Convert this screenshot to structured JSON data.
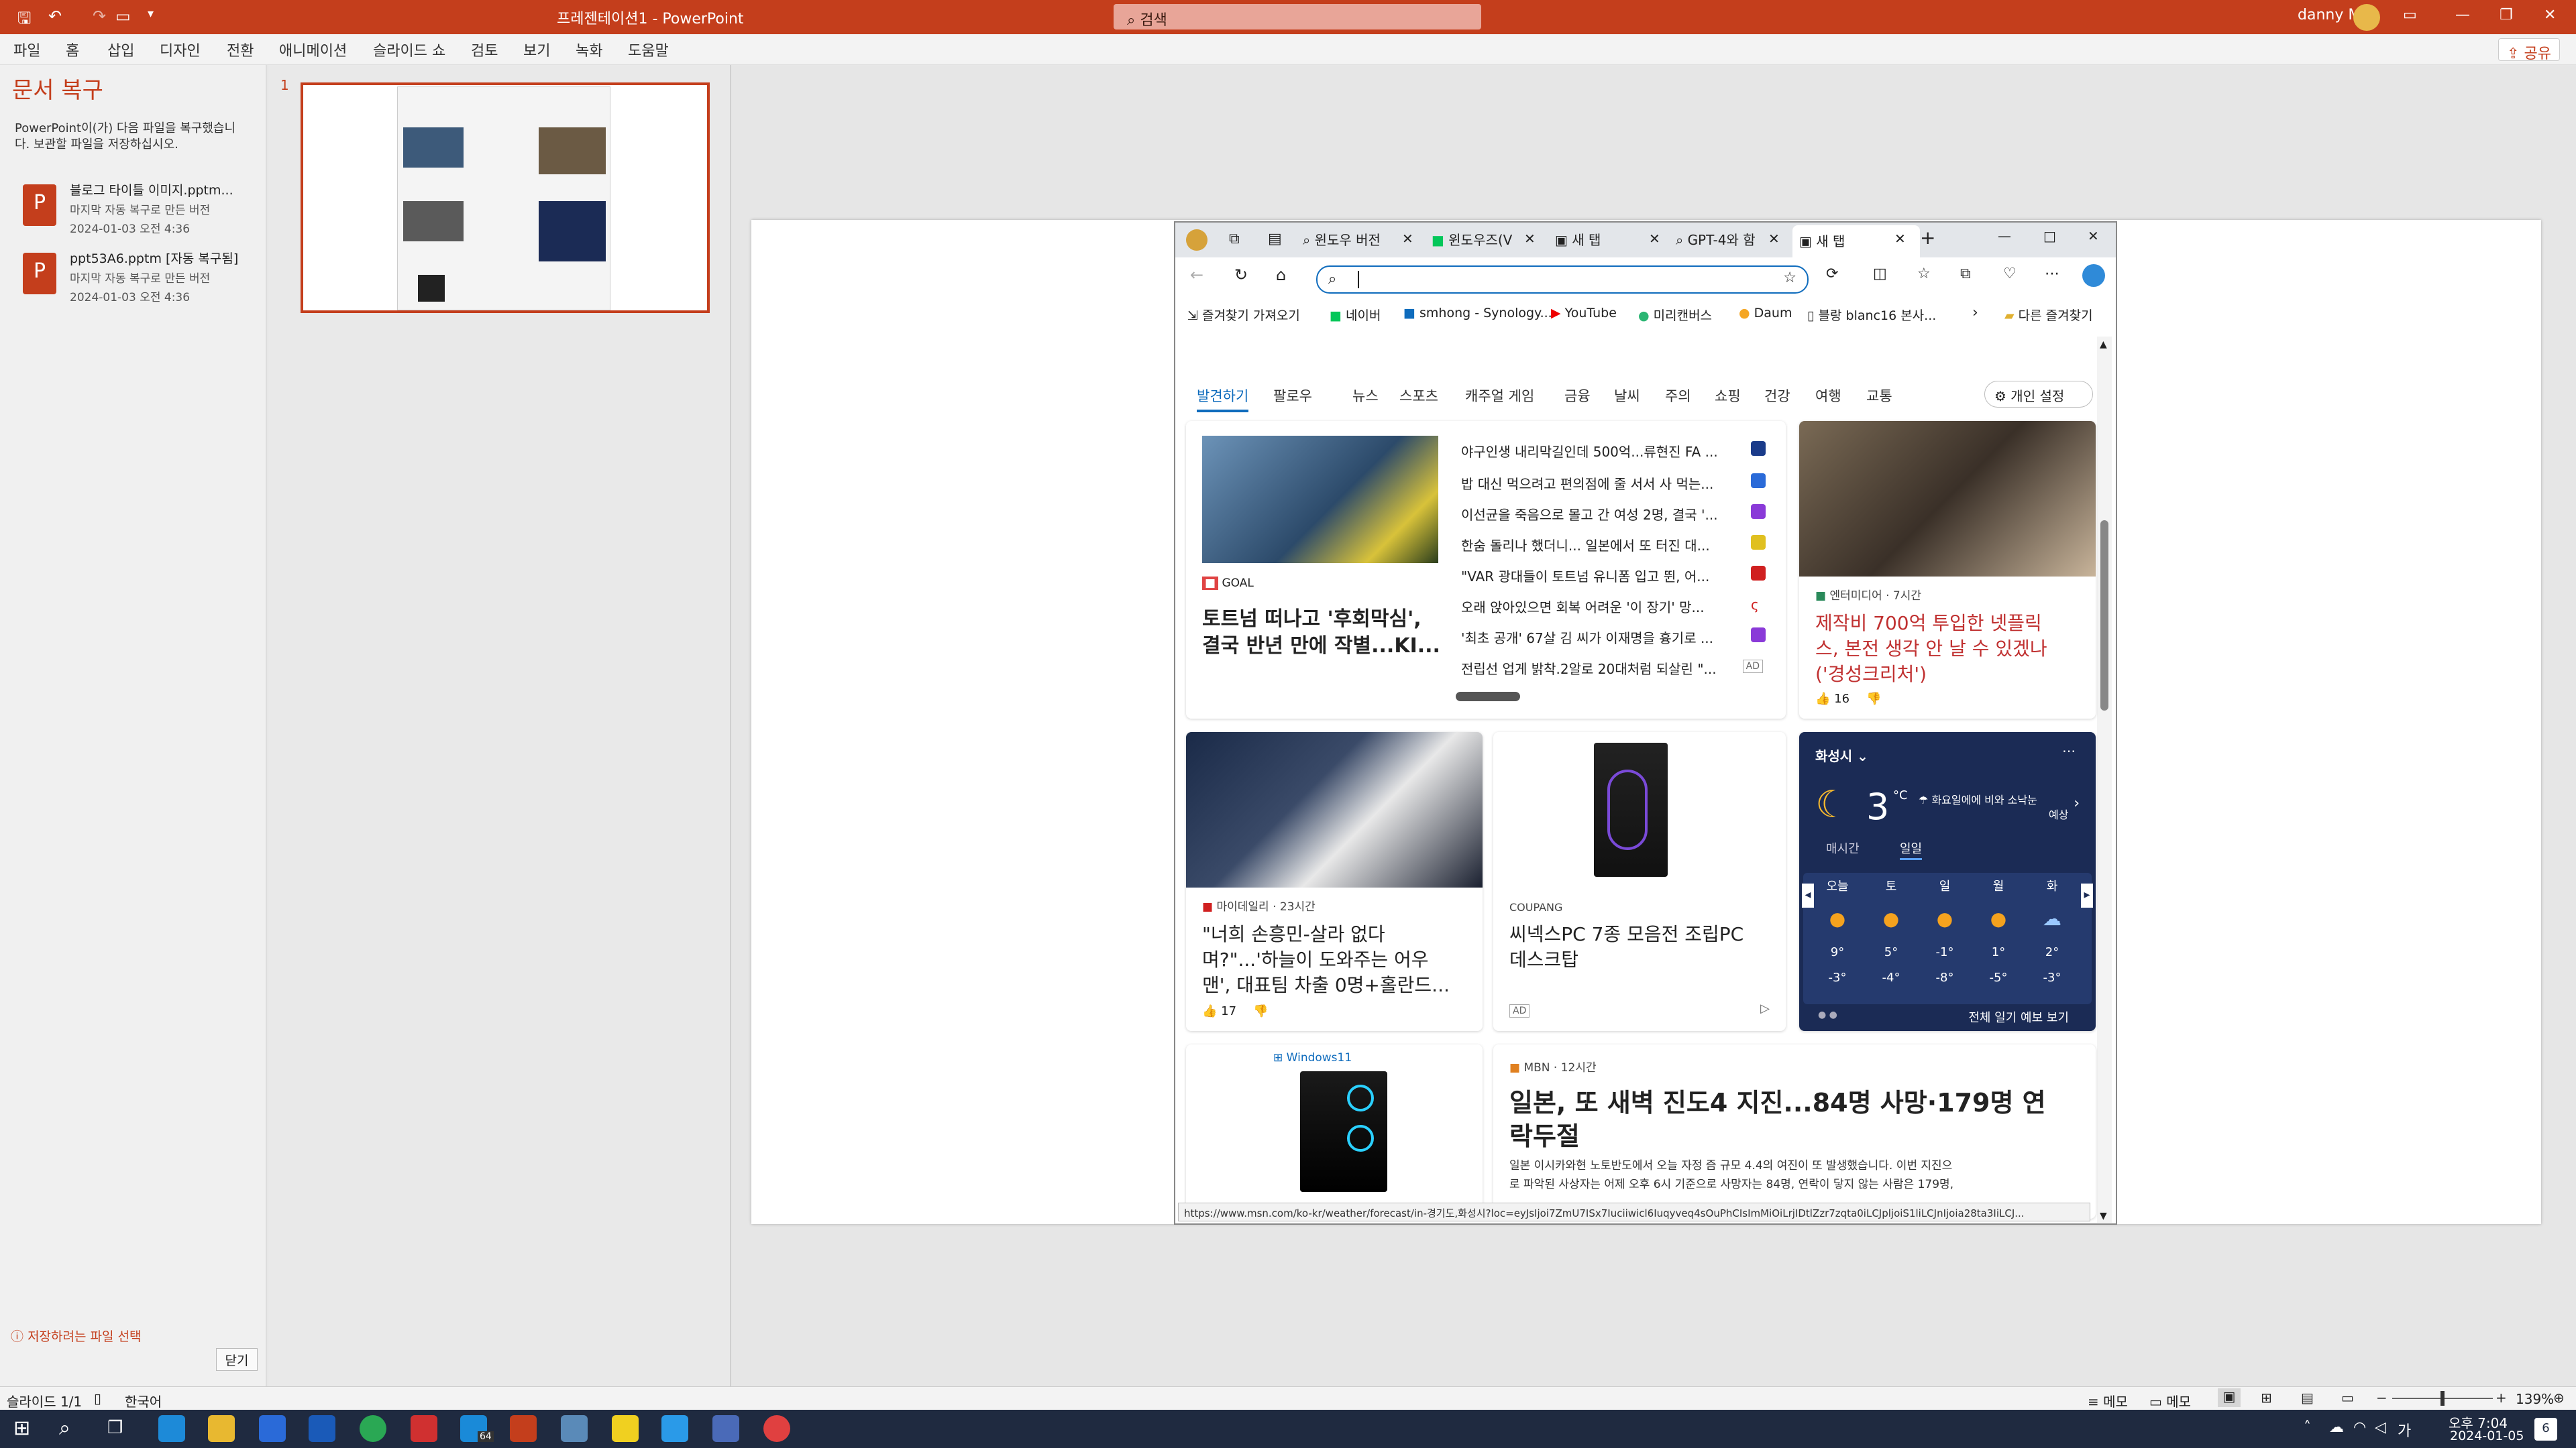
{
  "title_bar": {
    "doc_title": "프레젠테이션1",
    "separator": "-",
    "app": "PowerPoint",
    "search_placeholder": "검색",
    "user": "danny M"
  },
  "ribbon": {
    "tabs": [
      "파일",
      "홈",
      "삽입",
      "디자인",
      "전환",
      "애니메이션",
      "슬라이드 쇼",
      "검토",
      "보기",
      "녹화",
      "도움말"
    ],
    "share": "공유"
  },
  "recovery": {
    "title": "문서 복구",
    "desc_line1": "PowerPoint이(가) 다음 파일을 복구했습니",
    "desc_line2": "다. 보관할 파일을 저장하십시오.",
    "files": [
      {
        "name": "블로그 타이틀 이미지.pptm...",
        "meta1": "마지막 자동 복구로 만든 버전",
        "meta2": "2024-01-03 오전 4:36"
      },
      {
        "name": "ppt53A6.pptm  [자동 복구됨]",
        "meta1": "마지막 자동 복구로 만든 버전",
        "meta2": "2024-01-03 오전 4:36"
      }
    ],
    "which_link": "저장하려는 파일 선택",
    "close": "닫기"
  },
  "thumb_number": "1",
  "browser": {
    "tabs": [
      "윈도우 버전",
      "윈도우즈(V",
      "새 탭",
      "GPT-4와 함",
      "새 탭"
    ],
    "bookmarks": [
      "즐겨찾기 가져오기",
      "네이버",
      "smhong - Synology...",
      "YouTube",
      "미리캔버스",
      "Daum",
      "블랑 blanc16 본사...",
      "다른 즐겨찾기"
    ],
    "nav": [
      "발견하기",
      "팔로우",
      "뉴스",
      "스포츠",
      "캐주얼 게임",
      "금융",
      "날씨",
      "주의",
      "쇼핑",
      "건강",
      "여행",
      "교통"
    ],
    "personalize": "개인 설정",
    "main_card": {
      "source": "GOAL",
      "headline1": "토트넘 떠나고 '후회막심',",
      "headline2": "결국 반년 만에 작별...KI..."
    },
    "headlines": [
      "야구인생 내리막길인데 500억...류현진 FA ...",
      "밥 대신 먹으려고 편의점에 줄 서서 사 먹는...",
      "이선균을 죽음으로 몰고 간 여성 2명, 결국 '...",
      "한숨 돌리나 했더니... 일본에서 또 터진 대...",
      "\"VAR 광대들이 토트넘 유니폼 입고 뛴, 어...",
      "오래 앉아있으면 회복 어려운 '이 장기' 망...",
      "'최초 공개' 67살 김 씨가 이재명을 흉기로 ...",
      "전립선 업게 밝착.2알로 20대처럼 되살린 \"..."
    ],
    "ad_label": "AD",
    "ent_card": {
      "source": "엔터미디어 · 7시간",
      "headline1": "제작비 700억 투입한 넷플릭",
      "headline2": "스, 본전 생각 안 날 수 있겠나",
      "headline3": "('경성크리처')",
      "likes": "16"
    },
    "son_card": {
      "source": "마이데일리 · 23시간",
      "headline1": "\"너희 손흥민-살라 없다",
      "headline2": "며?\"...'하늘이 도와주는 어우",
      "headline3": "맨', 대표팀 차출 0명+홀란드...",
      "likes": "17"
    },
    "pc_card": {
      "source": "COUPANG",
      "headline1": "씨넥스PC 7종 모음전 조립PC",
      "headline2": "데스크탑",
      "ad": "AD"
    },
    "weather": {
      "city": "화성시",
      "temp": "3",
      "unit": "°C",
      "note1": "화요일에에 비와 소낙눈",
      "note2": "예상",
      "tab_hourly": "매시간",
      "tab_daily": "일일",
      "more": "전체 일기 예보 보기",
      "days": [
        {
          "d": "오늘",
          "hi": "9°",
          "lo": "-3°"
        },
        {
          "d": "토",
          "hi": "5°",
          "lo": "-4°"
        },
        {
          "d": "일",
          "hi": "-1°",
          "lo": "-8°"
        },
        {
          "d": "월",
          "hi": "1°",
          "lo": "-5°"
        },
        {
          "d": "화",
          "hi": "2°",
          "lo": "-3°"
        }
      ]
    },
    "win11_label": "Windows11",
    "mbn_card": {
      "source": "MBN · 12시간",
      "headline1": "일본, 또 새벽 진도4 지진...84명 사망·179명 연",
      "headline2": "락두절",
      "body1": "일본 이시카와현 노토반도에서 오늘 자정 즘 규모 4.4의 여진이 또 발생했습니다. 이번 지진으",
      "body2": "로 파악된 사상자는 어제 오후 6시 기준으로 사망자는 84명, 연락이 닿지 않는 사람은 179명,"
    },
    "status_url": "https://www.msn.com/ko-kr/weather/forecast/in-경기도,화성시?loc=eyJsIjoi7ZmU7ISx7Iuciiwicl6Iuqyveq4sOuPhCIsImMiOiLrjIDtlZzr7zqta0iLCJpljoiS1liLCJnIjoia28ta3IiLCJ..."
  },
  "statusbar": {
    "slide": "슬라이드 1/1",
    "lang": "한국어",
    "notes": "메모",
    "comments": "메모",
    "zoom": "139%"
  },
  "taskbar": {
    "time": "오후 7:04",
    "date": "2024-01-05",
    "badge": "64",
    "notif": "6",
    "ime": "가"
  },
  "colors": {
    "ppt": "#c43e1c",
    "edge_blue": "#0f6cbd",
    "weather_bg": "#1b2b55"
  }
}
